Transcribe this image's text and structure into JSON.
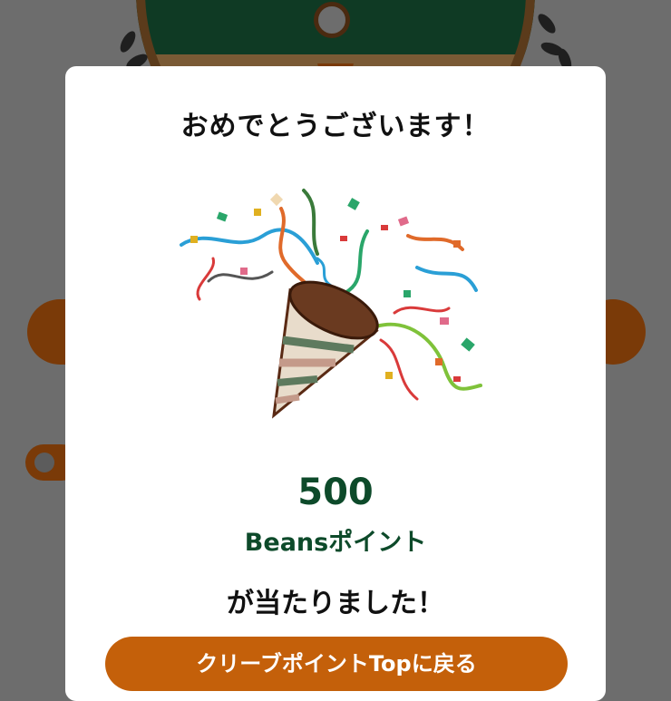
{
  "modal": {
    "title": "おめでとうございます！",
    "points_value": "500",
    "points_unit": "Beansポイント",
    "result_text": "が当たりました！",
    "cta_label": "クリーブポイントTopに戻る"
  },
  "colors": {
    "accent_green": "#0d4a2a",
    "button_orange": "#c4600a",
    "overlay_gray": "#6d6d6d"
  },
  "icons": [
    "party-popper-icon",
    "coffee-bean-icon"
  ]
}
